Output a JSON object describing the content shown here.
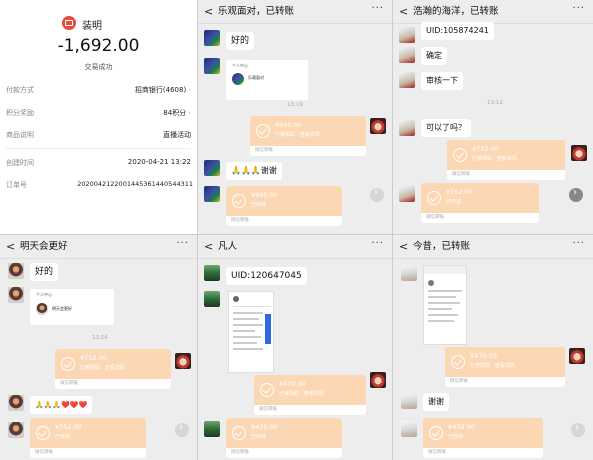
{
  "receipt": {
    "merchant": "装明",
    "amount": "-1,692.00",
    "status": "交易成功",
    "rows": [
      {
        "label": "付款方式",
        "value": "招商银行(4608)"
      },
      {
        "label": "积分奖励",
        "value": "84积分"
      },
      {
        "label": "商品说明",
        "value": "直播活动"
      },
      {
        "label": "创建时间",
        "value": "2020-04-21 13:22"
      },
      {
        "label": "订单号",
        "value": "20200421220014453614405443​11"
      }
    ],
    "chevron": "›"
  },
  "common": {
    "back": "<",
    "more": "···",
    "receipt_footer": "微信转账",
    "circle_next": "›"
  },
  "chat1": {
    "title": "乐观面对，已转账",
    "msg1": "好的",
    "card_header": "个人中心",
    "card_name": "乐观面对",
    "time": "13:19",
    "transfer1": {
      "amount": "¥940.00",
      "sub": "已被领取 · 查看详情"
    },
    "emoji_msg": "🙏🙏🙏谢谢",
    "transfer2": {
      "amount": "¥940.00",
      "sub": "已收钱"
    }
  },
  "chat2": {
    "title": "浩瀚的海洋，已转账",
    "uid": "UID:105874241",
    "msg_confirm": "确定",
    "msg_review": "审核一下",
    "time": "13:12",
    "msg_ok": "可以了吗？",
    "transfer1": {
      "amount": "¥752.00",
      "sub": "已被领取 · 查看详情"
    },
    "transfer2": {
      "amount": "¥752.00",
      "sub": "已收钱"
    }
  },
  "chat3": {
    "title": "明天会更好",
    "msg1": "好的",
    "card_header": "个人中心",
    "card_name": "明天会更好",
    "time": "13:14",
    "transfer1": {
      "amount": "¥752.00",
      "sub": "已被领取 · 查看详情"
    },
    "emoji_msg": "🙏🙏🙏❤️❤️❤️",
    "transfer2": {
      "amount": "¥752.00",
      "sub": "已收钱"
    }
  },
  "chat4": {
    "title": "凡人",
    "uid": "UID:120647045",
    "transfer1": {
      "amount": "¥470.00",
      "sub": "已被领取 · 查看详情"
    },
    "transfer2": {
      "amount": "¥470.00",
      "sub": "已收钱"
    }
  },
  "chat5": {
    "title": "今昔，已转账",
    "transfer1": {
      "amount": "¥470.00",
      "sub": "已被领取 · 查看详情"
    },
    "msg_thanks": "谢谢",
    "transfer2": {
      "amount": "¥470.00",
      "sub": "已收钱"
    }
  },
  "colors": {
    "transfer_orange": "#fbd7b4",
    "chat_bg": "#ededed",
    "merchant_red": "#e84c3d"
  }
}
